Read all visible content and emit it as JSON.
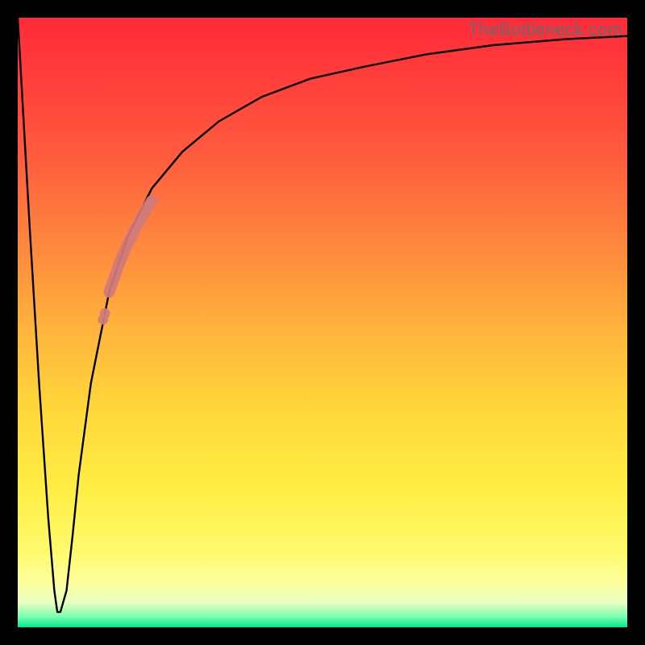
{
  "watermark": "TheBottleneck.com",
  "colors": {
    "curve": "#000000",
    "marker": "#cf7b7b",
    "frame": "#000000"
  },
  "chart_data": {
    "type": "line",
    "title": "",
    "xlabel": "",
    "ylabel": "",
    "xlim": [
      0,
      100
    ],
    "ylim": [
      0,
      100
    ],
    "annotations": [],
    "series": [
      {
        "name": "bottleneck-curve",
        "x": [
          0,
          2,
          3.5,
          5,
          6,
          6.5,
          7,
          8,
          9,
          10,
          12,
          15,
          18,
          22,
          27,
          33,
          40,
          48,
          57,
          67,
          78,
          90,
          100
        ],
        "y": [
          100,
          65,
          40,
          18,
          6,
          2.5,
          2.5,
          6,
          15,
          25,
          40,
          55,
          64,
          72,
          78,
          83,
          87,
          90,
          92,
          94,
          95.5,
          96.5,
          97
        ]
      }
    ],
    "highlight_segment": {
      "name": "marker-band",
      "x": [
        15.0,
        15.7,
        16.4,
        17.1,
        17.8,
        18.5,
        19.2,
        19.9,
        20.6,
        21.3,
        22.0
      ],
      "y": [
        55.0,
        57.0,
        59.0,
        60.8,
        62.4,
        63.8,
        65.2,
        66.5,
        67.7,
        68.9,
        70.0
      ]
    },
    "highlight_points": [
      {
        "x": 14.0,
        "y": 50.5
      },
      {
        "x": 14.3,
        "y": 51.5
      }
    ]
  }
}
